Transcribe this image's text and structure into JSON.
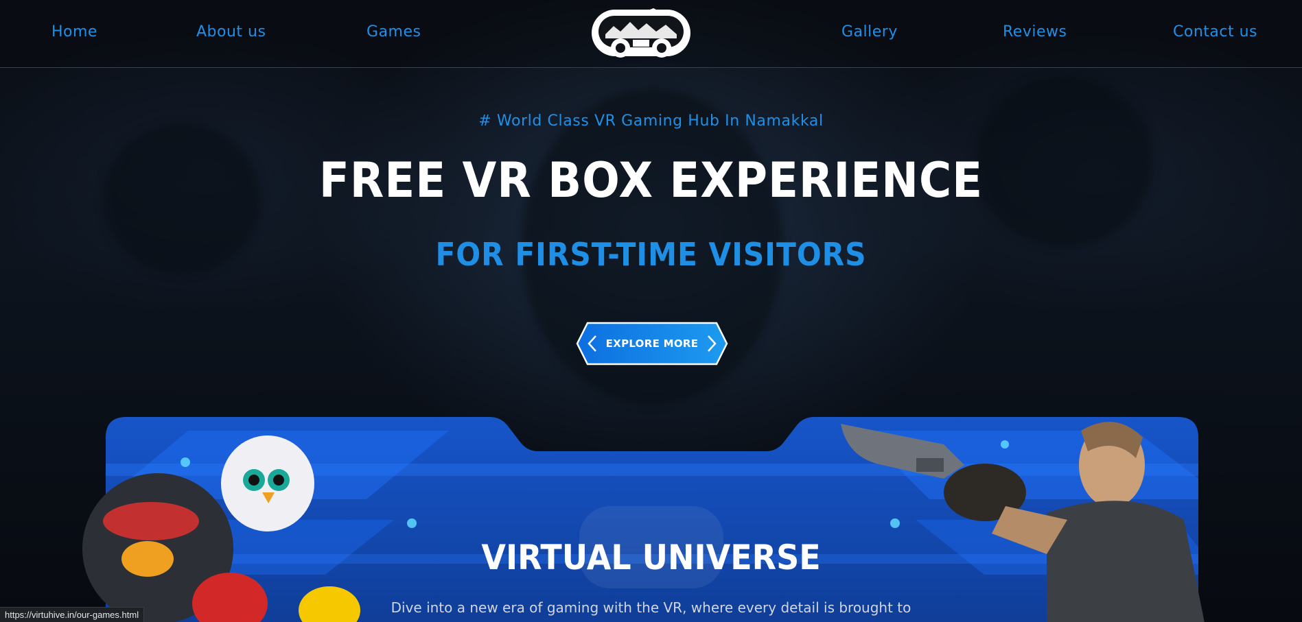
{
  "nav": {
    "left": [
      "Home",
      "About us",
      "Games"
    ],
    "right": [
      "Gallery",
      "Reviews",
      "Contact us"
    ]
  },
  "hero": {
    "tagline": "# World Class VR Gaming Hub In Namakkal",
    "title": "FREE VR BOX EXPERIENCE",
    "subtitle": "FOR FIRST-TIME VISITORS",
    "cta_label": "EXPLORE MORE"
  },
  "section": {
    "title": "VIRTUAL UNIVERSE",
    "text": "Dive into a new era of gaming with the VR, where every detail is brought to"
  },
  "status_bar": {
    "url": "https://virtuhive.in/our-games.html"
  },
  "colors": {
    "accent": "#1e90e8",
    "background": "#07090d",
    "panel_blue": "#1a5fd6"
  },
  "icons": {
    "logo": "vr-headset-logo-icon",
    "cta_left": "chevron-left-icon",
    "cta_right": "chevron-right-icon"
  }
}
